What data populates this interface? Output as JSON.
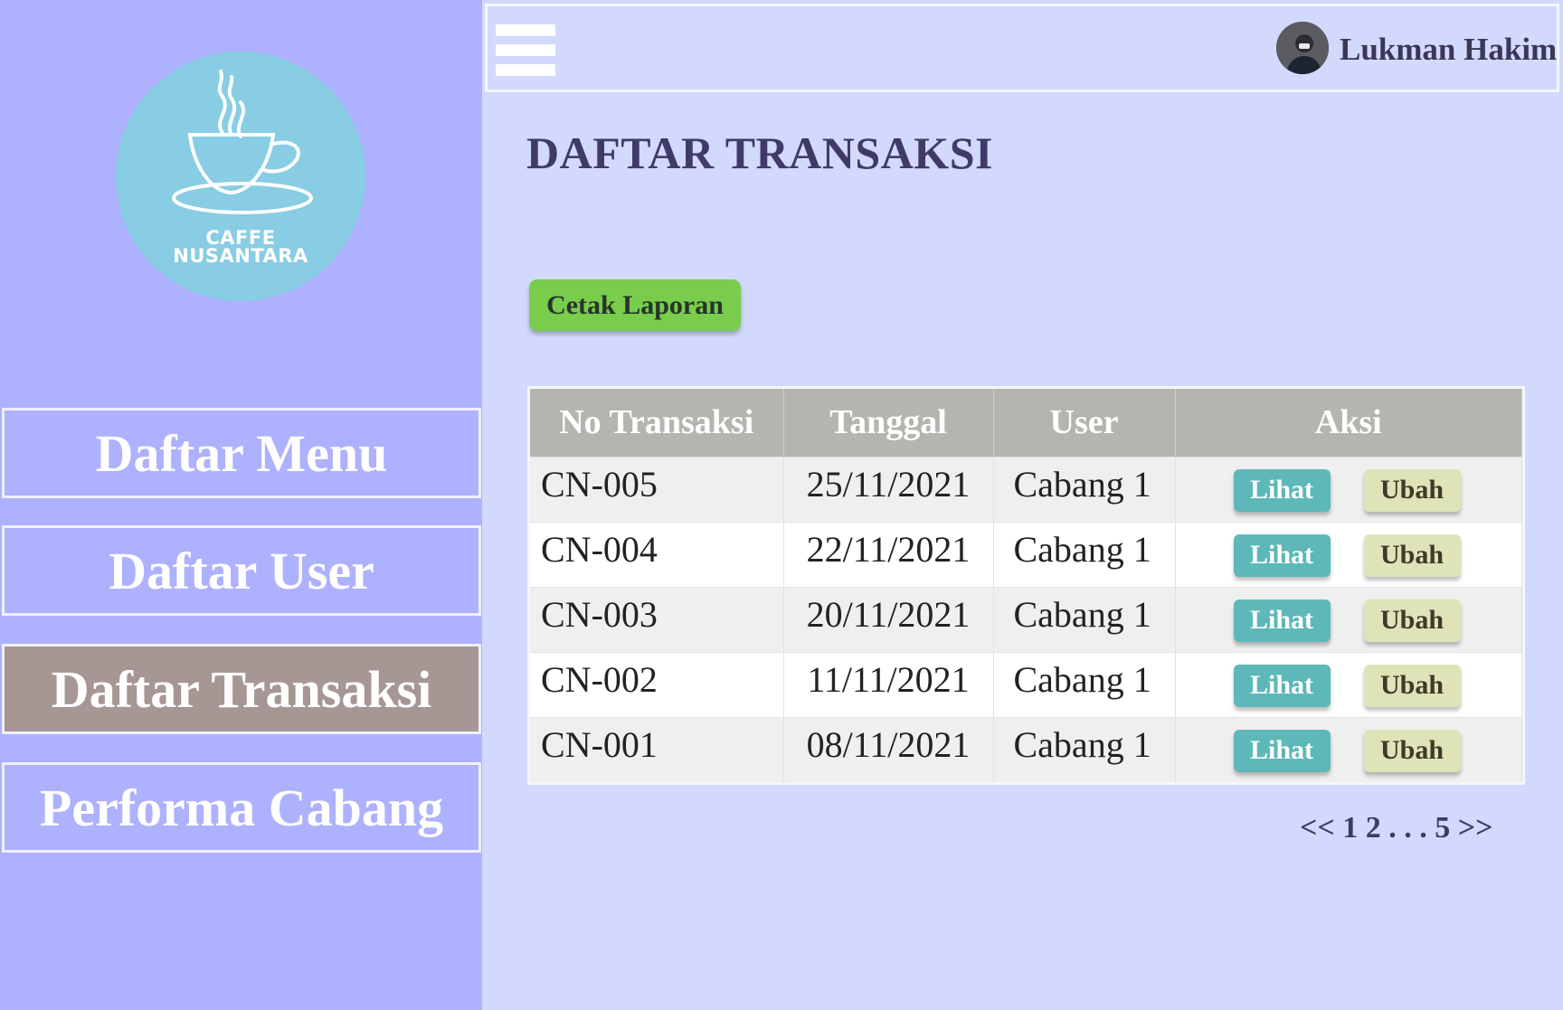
{
  "logo": {
    "line1": "CAFFE",
    "line2": "NUSANTARA",
    "icon": "coffee-cup-icon"
  },
  "sidebar": {
    "items": [
      {
        "label": "Daftar Menu",
        "active": false
      },
      {
        "label": "Daftar User",
        "active": false
      },
      {
        "label": "Daftar Transaksi",
        "active": true
      },
      {
        "label": "Performa Cabang",
        "active": false
      }
    ]
  },
  "header": {
    "user_name": "Lukman Hakim",
    "menu_icon": "hamburger-icon"
  },
  "main": {
    "title": "DAFTAR TRANSAKSI",
    "print_button": "Cetak Laporan",
    "table": {
      "columns": [
        "No Transaksi",
        "Tanggal",
        "User",
        "Aksi"
      ],
      "rows": [
        {
          "no": "CN-005",
          "tanggal": "25/11/2021",
          "user": "Cabang 1",
          "lihat": "Lihat",
          "ubah": "Ubah"
        },
        {
          "no": "CN-004",
          "tanggal": "22/11/2021",
          "user": "Cabang 1",
          "lihat": "Lihat",
          "ubah": "Ubah"
        },
        {
          "no": "CN-003",
          "tanggal": "20/11/2021",
          "user": "Cabang 1",
          "lihat": "Lihat",
          "ubah": "Ubah"
        },
        {
          "no": "CN-002",
          "tanggal": "11/11/2021",
          "user": "Cabang 1",
          "lihat": "Lihat",
          "ubah": "Ubah"
        },
        {
          "no": "CN-001",
          "tanggal": "08/11/2021",
          "user": "Cabang 1",
          "lihat": "Lihat",
          "ubah": "Ubah"
        }
      ]
    },
    "pagination": {
      "prev": "<<",
      "page1": "1",
      "page2": "2",
      "ellipsis": ". . .",
      "last": "5",
      "next": ">>"
    }
  },
  "colors": {
    "sidebar_bg": "#aeb1fe",
    "main_bg": "#d3d9fd",
    "active_nav": "#a69694",
    "print_button": "#79cc4c",
    "lihat_button": "#5eb8b9",
    "ubah_button": "#dfe3b8",
    "table_header": "#b4b5af"
  }
}
